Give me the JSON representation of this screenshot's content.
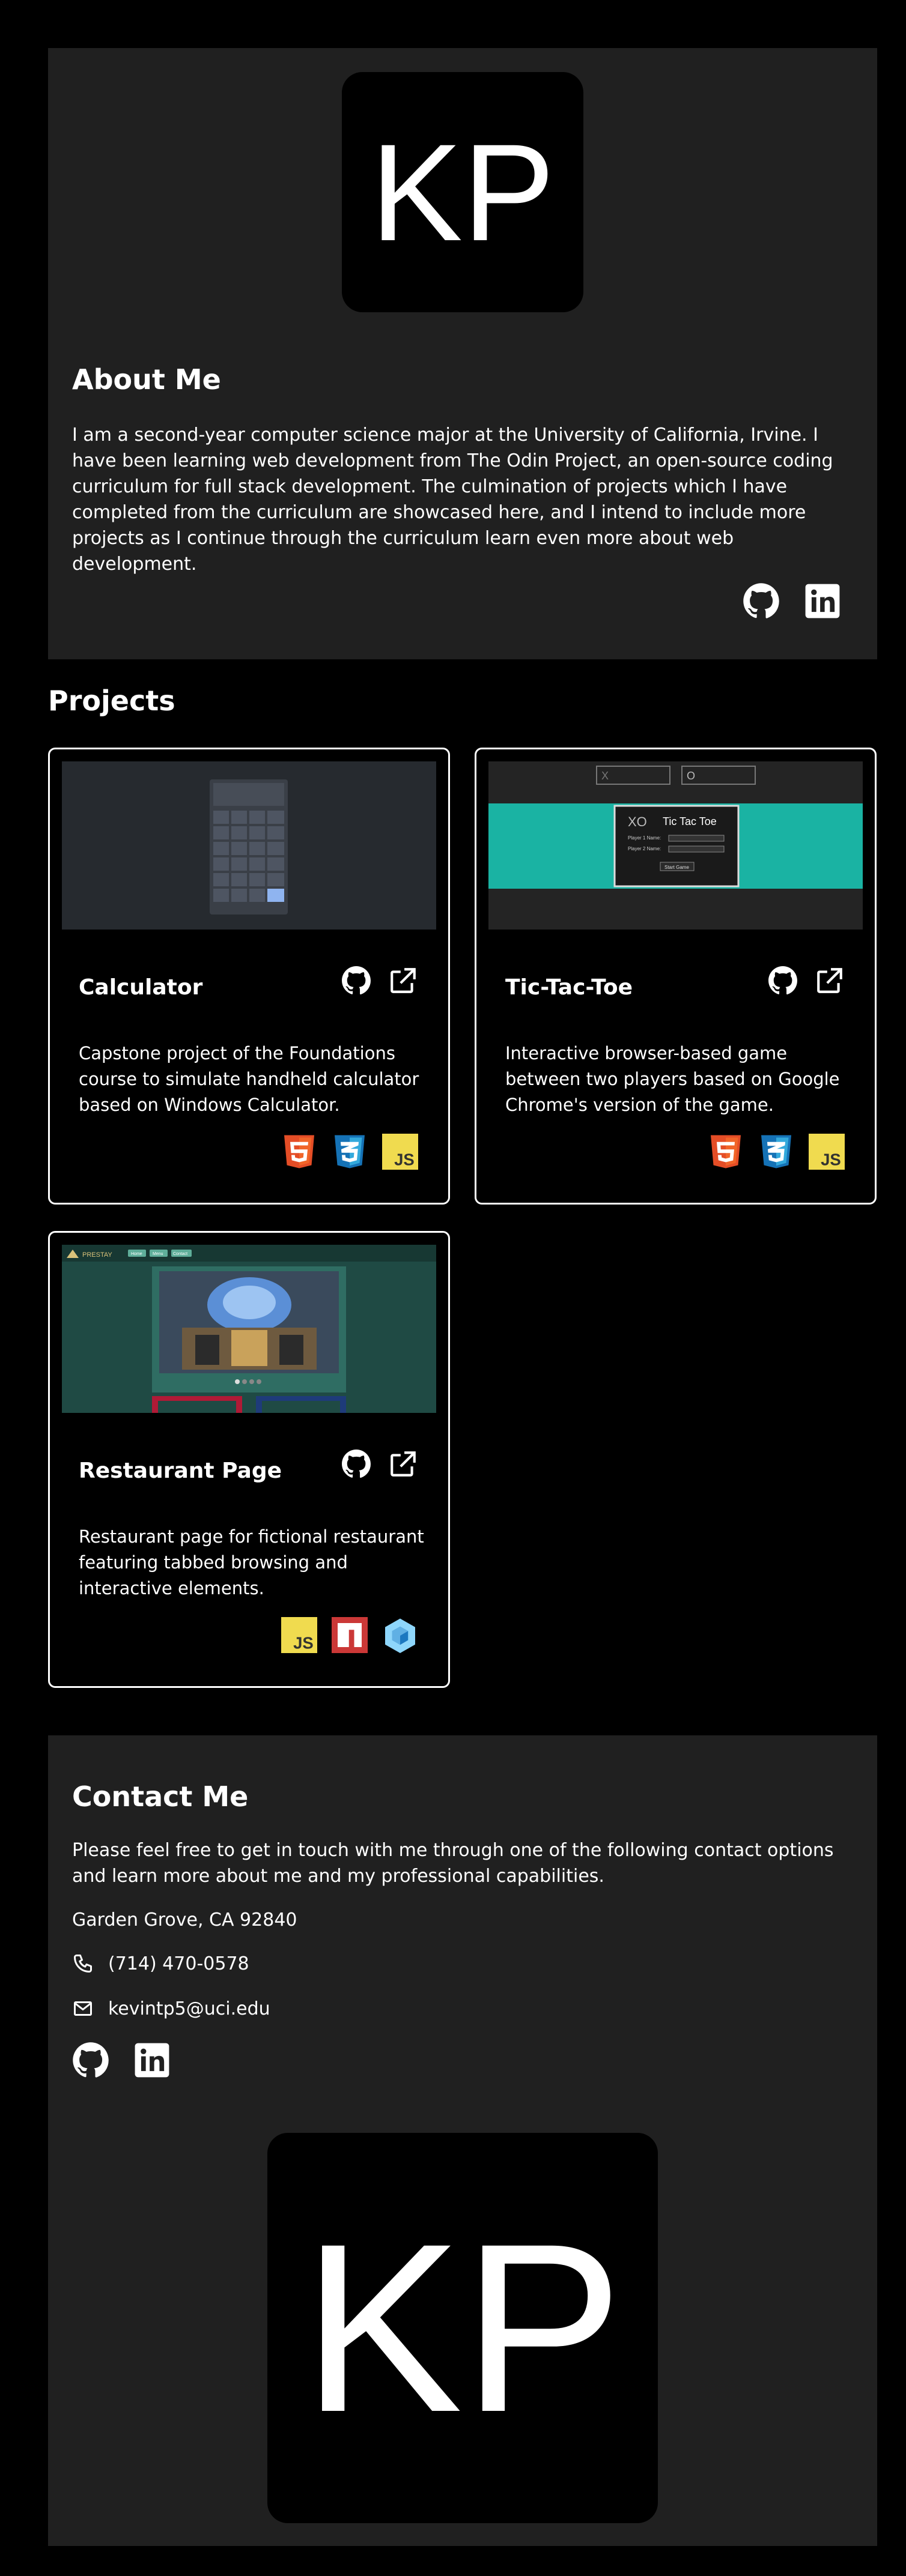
{
  "about": {
    "logo_text": "KP",
    "title": "About Me",
    "body": "I am a second-year computer science major at the University of California, Irvine. I have been learning web development from The Odin Project, an open-source coding curriculum for full stack development. The culmination of projects which I have completed from the curriculum are showcased here, and I intend to include more projects as I continue through the curriculum learn even more about web development."
  },
  "projects": {
    "title": "Projects",
    "items": [
      {
        "title": "Calculator",
        "description": "Capstone project of the Foundations course to simulate handheld calculator based on Windows Calculator.",
        "techs": [
          "html5-icon",
          "css3-icon",
          "javascript-icon"
        ]
      },
      {
        "title": "Tic-Tac-Toe",
        "description": "Interactive browser-based game between two players based on Google Chrome's version of the game.",
        "techs": [
          "html5-icon",
          "css3-icon",
          "javascript-icon"
        ],
        "thumb": {
          "input_x": "X",
          "input_o": "O",
          "modal_title": "Tic Tac Toe",
          "player1": "Player 1 Name:",
          "player2": "Player 2 Name:",
          "start": "Start Game"
        }
      },
      {
        "title": "Restaurant Page",
        "description": "Restaurant page for fictional restaurant featuring tabbed browsing and interactive elements.",
        "techs": [
          "javascript-icon",
          "npm-icon",
          "webpack-icon"
        ],
        "thumb": {
          "brand": "PRESTAY",
          "tabs": [
            "Home",
            "Menu",
            "Contact"
          ]
        }
      }
    ]
  },
  "contact": {
    "title": "Contact Me",
    "intro": "Please feel free to get in touch with me through one of the following contact options and learn more about me and my professional capabilities.",
    "address": "Garden Grove, CA 92840",
    "phone": "(714) 470-0578",
    "email": "kevintp5@uci.edu",
    "logo_text": "KP"
  },
  "colors": {
    "page_bg": "#000000",
    "panel_bg": "#202020",
    "html5": "#e44d26",
    "css3": "#1572b6",
    "javascript": "#f0db4f",
    "npm": "#cb3837",
    "webpack": "#8ed6fb",
    "tictactoe_teal": "#1ab3a3"
  }
}
